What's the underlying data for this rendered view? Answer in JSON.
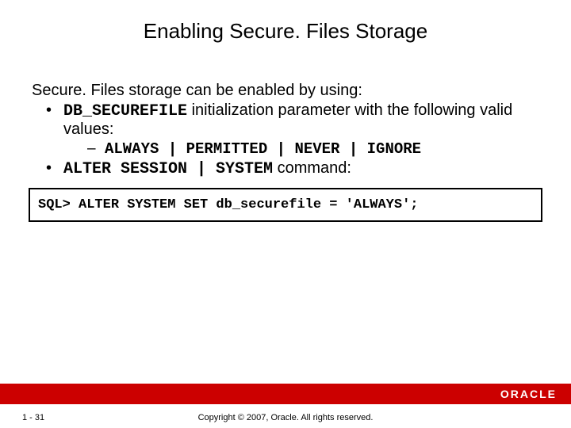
{
  "title": "Enabling Secure. Files Storage",
  "intro": "Secure. Files storage can be enabled by using:",
  "bullets": {
    "b1_pre": "DB_SECUREFILE",
    "b1_post": " initialization parameter with the following valid values:",
    "sub1": "ALWAYS | PERMITTED | NEVER | IGNORE",
    "b2_pre": "ALTER SESSION | SYSTEM",
    "b2_post": " command:"
  },
  "code": "SQL> ALTER SYSTEM SET db_securefile = 'ALWAYS';",
  "footer": {
    "logo": "ORACLE",
    "page": "1 - 31",
    "copyright": "Copyright © 2007, Oracle. All rights reserved."
  }
}
